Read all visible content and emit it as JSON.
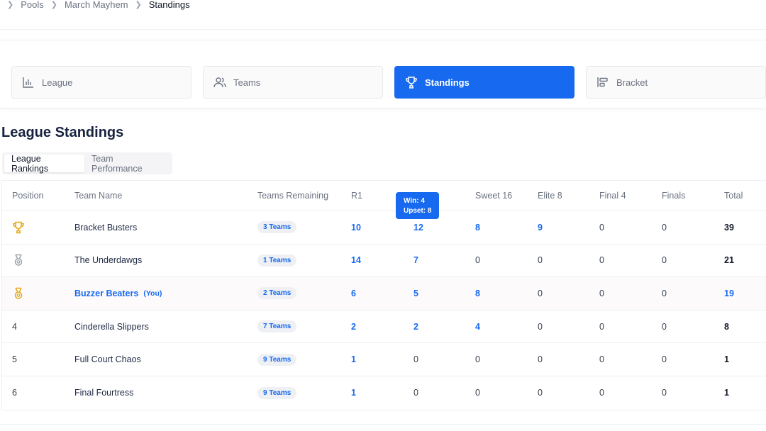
{
  "breadcrumb": {
    "items": [
      "Pools",
      "March Mayhem",
      "Standings"
    ]
  },
  "nav": {
    "cards": [
      {
        "label": "League",
        "icon": "bar-chart-icon"
      },
      {
        "label": "Teams",
        "icon": "users-icon"
      },
      {
        "label": "Standings",
        "icon": "trophy-icon",
        "active": true
      },
      {
        "label": "Bracket",
        "icon": "bracket-icon"
      }
    ]
  },
  "page_title": "League Standings",
  "subtabs": {
    "rankings": "League Rankings",
    "performance": "Team Performance"
  },
  "table": {
    "headers": {
      "position": "Position",
      "team": "Team Name",
      "remaining": "Teams Remaining",
      "r1": "R1",
      "sweet16": "Sweet 16",
      "elite8": "Elite 8",
      "final4": "Final 4",
      "finals": "Finals",
      "total": "Total"
    },
    "rows": [
      {
        "pos": "",
        "medal": "gold-trophy-icon",
        "team": "Bracket Busters",
        "remaining": "3 Teams",
        "r1": "10",
        "r2": "12",
        "s16": "8",
        "e8": "9",
        "f4": "0",
        "fin": "0",
        "total": "39"
      },
      {
        "pos": "",
        "medal": "silver-medal-icon",
        "team": "The Underdawgs",
        "remaining": "1 Teams",
        "r1": "14",
        "r2": "7",
        "s16": "0",
        "e8": "0",
        "f4": "0",
        "fin": "0",
        "total": "21"
      },
      {
        "pos": "",
        "medal": "bronze-medal-icon",
        "team": "Buzzer Beaters",
        "you_tag": "(You)",
        "remaining": "2 Teams",
        "r1": "6",
        "r2": "5",
        "s16": "8",
        "e8": "0",
        "f4": "0",
        "fin": "0",
        "total": "19"
      },
      {
        "pos": "4",
        "team": "Cinderella Slippers",
        "remaining": "7 Teams",
        "r1": "2",
        "r2": "2",
        "s16": "4",
        "e8": "0",
        "f4": "0",
        "fin": "0",
        "total": "8"
      },
      {
        "pos": "5",
        "team": "Full Court Chaos",
        "remaining": "9 Teams",
        "r1": "1",
        "r2": "0",
        "s16": "0",
        "e8": "0",
        "f4": "0",
        "fin": "0",
        "total": "1"
      },
      {
        "pos": "6",
        "team": "Final Fourtress",
        "remaining": "9 Teams",
        "r1": "1",
        "r2": "0",
        "s16": "0",
        "e8": "0",
        "f4": "0",
        "fin": "0",
        "total": "1"
      }
    ]
  },
  "tooltip": {
    "win": "Win: 4",
    "upset": "Upset: 8"
  },
  "colors": {
    "accent": "#1769f0",
    "gold": "#e6a817",
    "silver": "#9aa3ae"
  }
}
